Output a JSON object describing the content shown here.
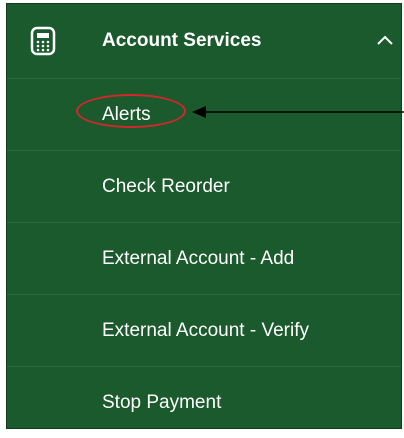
{
  "menu": {
    "header": {
      "label": "Account Services",
      "icon": "calculator-icon",
      "chevron": "chevron-up-icon"
    },
    "items": [
      {
        "label": "Alerts"
      },
      {
        "label": "Check Reorder"
      },
      {
        "label": "External Account - Add"
      },
      {
        "label": "External Account - Verify"
      },
      {
        "label": "Stop Payment"
      }
    ]
  },
  "annotation": {
    "highlight_target": "Alerts",
    "highlight_color": "#d0282c",
    "arrow_icon": "arrow-left-icon"
  },
  "colors": {
    "panel_background": "#1a5a2c",
    "divider": "#2a6b3a",
    "text": "#ffffff"
  }
}
